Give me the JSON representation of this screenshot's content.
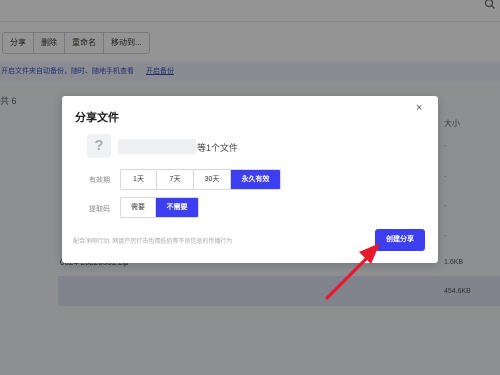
{
  "toolbar": {
    "buttons": [
      "分享",
      "删除",
      "重命名",
      "移动到..."
    ]
  },
  "banner": {
    "text": "开启文件夹自动备份，随时、随地手机查看",
    "link": "开启备份"
  },
  "list": {
    "count_label": "共 6",
    "size_header": "大小",
    "dash": "-",
    "file_name": "0624-20220531.zip",
    "sizes": [
      "1.6KB",
      "454.6KB"
    ]
  },
  "dialog": {
    "title": "分享文件",
    "close": "×",
    "file_icon": "?",
    "file_count": "等1个文件",
    "validity": {
      "label": "有效期",
      "options": [
        "1天",
        "7天",
        "30天",
        "永久有效"
      ],
      "selected": "永久有效"
    },
    "code": {
      "label": "提取码",
      "options": [
        "需要",
        "不需要"
      ],
      "selected": "不需要"
    },
    "footnote": "配合净网行动, 网盘严厉打击色情低俗等不良信息的传播行为",
    "create_button": "创建分享"
  },
  "colors": {
    "accent": "#3d3ef0",
    "arrow": "#e8192c"
  },
  "icons": [
    "search-icon",
    "close-icon",
    "unknown-file-icon",
    "red-arrow-annotation"
  ]
}
